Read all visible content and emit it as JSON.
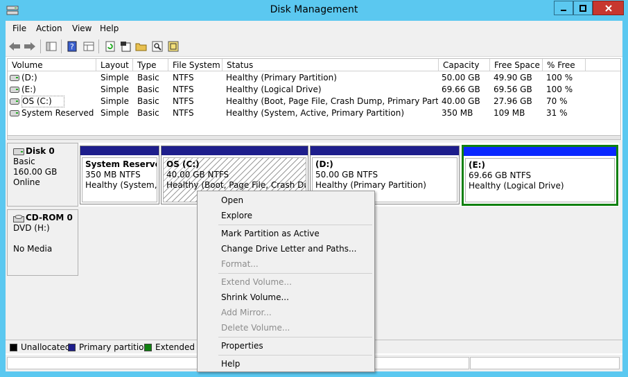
{
  "window": {
    "title": "Disk Management"
  },
  "menu": [
    "File",
    "Action",
    "View",
    "Help"
  ],
  "toolbar": {
    "icons": [
      "back-arrow-icon",
      "forward-arrow-icon",
      "console-tree-icon",
      "help-icon",
      "properties-grid-icon",
      "refresh-icon",
      "properties-icon",
      "open-folder-icon",
      "search-icon",
      "settings-icon"
    ]
  },
  "volume_list": {
    "columns": [
      "Volume",
      "Layout",
      "Type",
      "File System",
      "Status",
      "Capacity",
      "Free Space",
      "% Free"
    ],
    "rows": [
      [
        "(D:)",
        "Simple",
        "Basic",
        "NTFS",
        "Healthy (Primary Partition)",
        "50.00 GB",
        "49.90 GB",
        "100 %"
      ],
      [
        "(E:)",
        "Simple",
        "Basic",
        "NTFS",
        "Healthy (Logical Drive)",
        "69.66 GB",
        "69.56 GB",
        "100 %"
      ],
      [
        "OS (C:)",
        "Simple",
        "Basic",
        "NTFS",
        "Healthy (Boot, Page File, Crash Dump, Primary Partition)",
        "40.00 GB",
        "27.96 GB",
        "70 %"
      ],
      [
        "System Reserved",
        "Simple",
        "Basic",
        "NTFS",
        "Healthy (System, Active, Primary Partition)",
        "350 MB",
        "109 MB",
        "31 %"
      ]
    ]
  },
  "disks": {
    "disk0": {
      "name": "Disk 0",
      "type": "Basic",
      "size": "160.00 GB",
      "state": "Online"
    },
    "cdrom": {
      "name": "CD-ROM 0",
      "type": "DVD (H:)",
      "state": "No Media"
    }
  },
  "partitions": [
    {
      "name": "System Reserved",
      "size": "350 MB NTFS",
      "status": "Healthy (System, Active, Primary Partition)"
    },
    {
      "name": "OS  (C:)",
      "size": "40.00 GB NTFS",
      "status": "Healthy (Boot, Page File, Crash Dump, Primary Partition)"
    },
    {
      "name": "(D:)",
      "size": "50.00 GB NTFS",
      "status": "Healthy (Primary Partition)"
    },
    {
      "name": "(E:)",
      "size": "69.66 GB NTFS",
      "status": "Healthy (Logical Drive)"
    }
  ],
  "legend": [
    {
      "label": "Unallocated",
      "color": "#000000"
    },
    {
      "label": "Primary partition",
      "color": "#1e1e8c"
    },
    {
      "label": "Extended partition",
      "color": "#108010"
    }
  ],
  "context_menu": {
    "items": [
      {
        "label": "Open",
        "enabled": true
      },
      {
        "label": "Explore",
        "enabled": true
      },
      {
        "label": "Mark Partition as Active",
        "enabled": true
      },
      {
        "label": "Change Drive Letter and Paths...",
        "enabled": true
      },
      {
        "label": "Format...",
        "enabled": false
      },
      {
        "label": "Extend Volume...",
        "enabled": false
      },
      {
        "label": "Shrink Volume...",
        "enabled": true
      },
      {
        "label": "Add Mirror...",
        "enabled": false
      },
      {
        "label": "Delete Volume...",
        "enabled": false
      },
      {
        "label": "Properties",
        "enabled": true
      },
      {
        "label": "Help",
        "enabled": true
      }
    ]
  },
  "colors": {
    "titlebar": "#5bc8f0",
    "primary": "#1e1e8c",
    "logical": "#0a28ff",
    "selection": "#108010",
    "close": "#c7372f"
  }
}
